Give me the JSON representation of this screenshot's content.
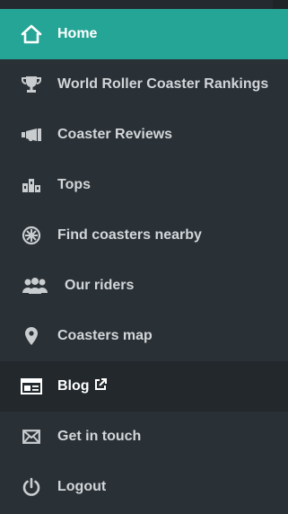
{
  "colors": {
    "background": "#293036",
    "active": "#25a596",
    "highlight": "#22282c",
    "text": "#d2d6d9",
    "icon": "#c9cdd0"
  },
  "menu": {
    "items": [
      {
        "label": "Home",
        "icon": "home-icon",
        "active": true
      },
      {
        "label": "World Roller Coaster Rankings",
        "icon": "trophy-icon"
      },
      {
        "label": "Coaster Reviews",
        "icon": "megaphone-icon"
      },
      {
        "label": "Tops",
        "icon": "podium-icon"
      },
      {
        "label": "Find coasters nearby",
        "icon": "compass-icon"
      },
      {
        "label": "Our riders",
        "icon": "users-icon"
      },
      {
        "label": "Coasters map",
        "icon": "map-pin-icon"
      },
      {
        "label": "Blog",
        "icon": "newspaper-icon",
        "external": true,
        "highlight": true
      },
      {
        "label": "Get in touch",
        "icon": "envelope-icon"
      },
      {
        "label": "Logout",
        "icon": "power-icon"
      }
    ]
  }
}
